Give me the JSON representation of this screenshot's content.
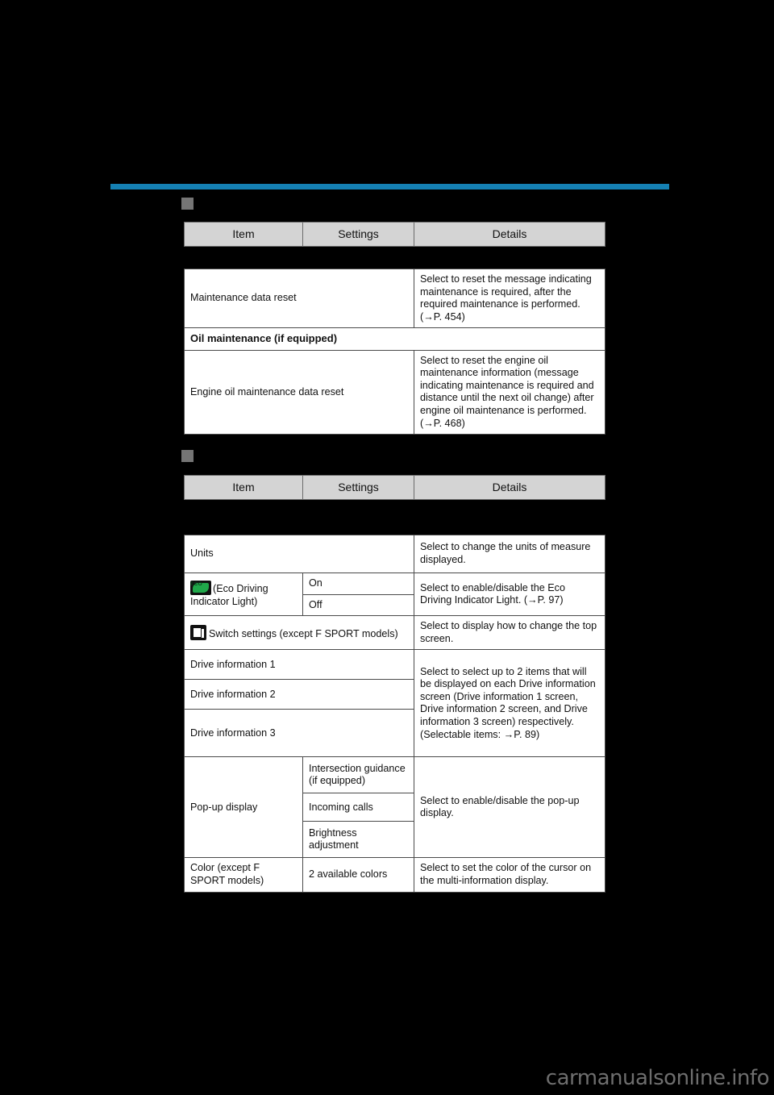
{
  "page": {
    "background_color": "#000000",
    "rule_color": "#1580b3",
    "marker_color": "#757575",
    "header_fill": "#d4d4d4",
    "watermark": "carmanualsonline.info"
  },
  "columns": {
    "item": "Item",
    "settings": "Settings",
    "details": "Details"
  },
  "sections": [
    {
      "marker": "square-marker",
      "heading": "",
      "rows": [
        {
          "item": "Maintenance data reset",
          "settings": "",
          "details": "Select to reset the message indicating maintenance is required, after the required maintenance is performed. (→P. 454)"
        },
        {
          "type": "subheading",
          "item": "Oil maintenance (if equipped)"
        },
        {
          "item": "Engine oil maintenance data reset",
          "settings": "",
          "details": "Select to reset the engine oil maintenance information (message indicating maintenance is required and distance until the next oil change) after engine oil maintenance is performed. (→P. 468)"
        }
      ]
    },
    {
      "marker": "square-marker",
      "heading": "",
      "rows": [
        {
          "item": "Units",
          "settings": "",
          "details": "Select to change the units of measure displayed."
        },
        {
          "icon": "eco-driving-indicator-icon",
          "icon_label": "ECO",
          "item": "(Eco Driving Indicator Light)",
          "settings_options": [
            "On",
            "Off"
          ],
          "details": "Select to enable/disable the Eco Driving Indicator Light. (→P. 97)"
        },
        {
          "icon": "switch-settings-icon",
          "item": "Switch settings (except F SPORT models)",
          "settings": "",
          "details": "Select to display how to change the top screen."
        },
        {
          "item": "Drive information 1",
          "settings": "",
          "details": "Select to select up to 2 items that will be displayed on each Drive information screen (Drive information 1 screen, Drive information 2 screen, and Drive information 3 screen) respectively.\n(Selectable items: →P. 89)"
        },
        {
          "item": "Drive information 2"
        },
        {
          "item": "Drive information 3"
        },
        {
          "item": "Pop-up display",
          "settings_options": [
            "Intersection guidance (if equipped)",
            "Incoming calls",
            "Brightness adjustment"
          ],
          "details": "Select to enable/disable the pop-up display."
        },
        {
          "item": "Color (except F SPORT models)",
          "settings": "2 available colors",
          "details": "Select to set the color of the cursor on the multi-information display."
        }
      ]
    }
  ]
}
